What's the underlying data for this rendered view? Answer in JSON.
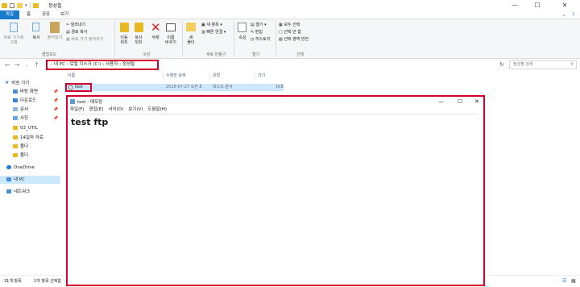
{
  "window": {
    "title": "정성필",
    "minimize": "—",
    "maximize": "☐",
    "close": "✕",
    "help": "?"
  },
  "tabs": [
    "파일",
    "홈",
    "공유",
    "보기"
  ],
  "ribbon": {
    "pin_quick": [
      "바로 가기에",
      "고정"
    ],
    "copy": "복사",
    "paste": "붙여넣기",
    "cut": "잘라내기",
    "copy_path": "경로 복사",
    "paste_shortcut": "바로 가기 붙여넣기",
    "clipboard_group": "클립보드",
    "move_to": [
      "이동",
      "위치"
    ],
    "copy_to": [
      "복사",
      "위치"
    ],
    "delete": "삭제",
    "rename": [
      "이름",
      "바꾸기"
    ],
    "organize_group": "구성",
    "new_folder": [
      "새",
      "폴더"
    ],
    "new_item": "새 항목",
    "easy_access": "빠른 연결",
    "new_group": "새로 만들기",
    "properties": "속성",
    "open": "열기",
    "edit": "편집",
    "history": "히스토리",
    "open_group": "열기",
    "select_all": "모두 선택",
    "select_none": "선택 안 함",
    "invert_select": "선택 영역 반전",
    "select_group": "선택"
  },
  "address": {
    "segments": [
      "내 PC",
      "로컬 디스크 (C:)",
      "사용자",
      "정성필"
    ],
    "search_placeholder": "정성필 검색"
  },
  "sidebar": {
    "items": [
      {
        "label": "바로 가기",
        "pinned": false,
        "icon": "star-icon"
      },
      {
        "label": "바탕 화면",
        "pinned": true,
        "icon": "folder-blue-icon"
      },
      {
        "label": "다운로드",
        "pinned": true,
        "icon": "download-icon"
      },
      {
        "label": "문서",
        "pinned": true,
        "icon": "document-icon"
      },
      {
        "label": "사진",
        "pinned": true,
        "icon": "picture-icon"
      },
      {
        "label": "03_UTIL",
        "pinned": false,
        "icon": "folder-icon"
      },
      {
        "label": "14일차 자료",
        "pinned": false,
        "icon": "folder-icon"
      },
      {
        "label": "폴더",
        "pinned": false,
        "icon": "folder-icon"
      },
      {
        "label": "폴더",
        "pinned": false,
        "icon": "folder-icon"
      },
      {
        "label": "OneDrive",
        "pinned": false,
        "icon": "cloud-icon"
      },
      {
        "label": "내 PC",
        "pinned": false,
        "icon": "computer-icon"
      },
      {
        "label": "네트워크",
        "pinned": false,
        "icon": "network-icon"
      }
    ],
    "pin_glyph": "📌"
  },
  "columns": [
    "이름",
    "수정한 날짜",
    "유형",
    "크기"
  ],
  "files": [
    {
      "name": "test",
      "modified": "2018-07-27 오전 8",
      "type": "텍스트 문서",
      "size": "1KB"
    }
  ],
  "status": {
    "count": "31개 항목",
    "selected": "1개 항목 선택함"
  },
  "notepad": {
    "title": "test - 메모장",
    "menu": [
      "파일(F)",
      "편집(E)",
      "서식(O)",
      "보기(V)",
      "도움말(H)"
    ],
    "content": "test ftp"
  },
  "colors": {
    "accent": "#1979ca",
    "highlight_border": "#d4002b",
    "selection": "#cce8ff"
  }
}
